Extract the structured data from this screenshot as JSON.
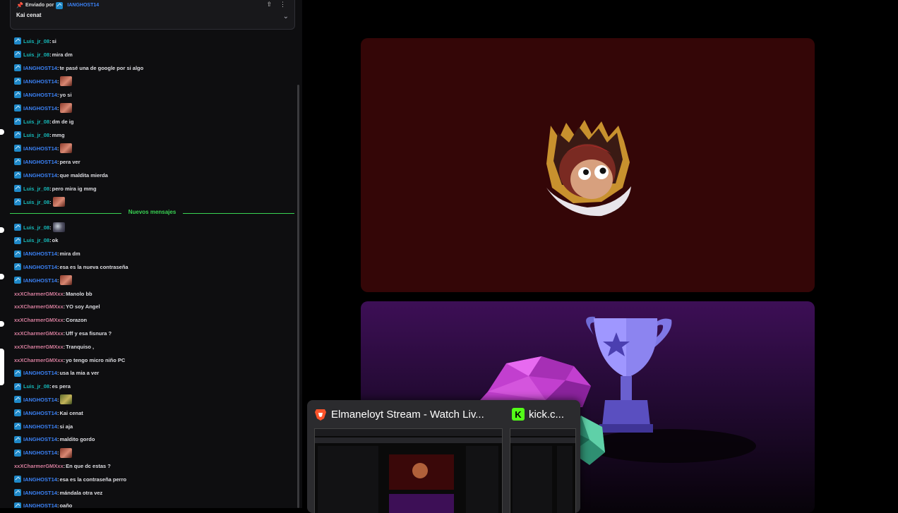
{
  "pinned": {
    "label": "Enviado por",
    "author": "IANGHOST14",
    "message": "Kai cenat"
  },
  "separator": {
    "label": "Nuevos mensajes"
  },
  "messages": [
    {
      "user": "Luis_jr_08",
      "color": "#16b9b9",
      "text": "si",
      "badge": true,
      "emote": ""
    },
    {
      "user": "Luis_jr_08",
      "color": "#16b9b9",
      "text": "mira dm",
      "badge": true,
      "emote": ""
    },
    {
      "user": "IANGHOST14",
      "color": "#3b82f6",
      "text": "te pasé una de google por si algo",
      "badge": true,
      "emote": ""
    },
    {
      "user": "IANGHOST14",
      "color": "#3b82f6",
      "text": "",
      "badge": true,
      "emote": "face"
    },
    {
      "user": "IANGHOST14",
      "color": "#3b82f6",
      "text": "yo si",
      "badge": true,
      "emote": ""
    },
    {
      "user": "IANGHOST14",
      "color": "#3b82f6",
      "text": "",
      "badge": true,
      "emote": "face"
    },
    {
      "user": "Luis_jr_08",
      "color": "#16b9b9",
      "text": "dm de ig",
      "badge": true,
      "emote": ""
    },
    {
      "user": "Luis_jr_08",
      "color": "#16b9b9",
      "text": "mmg",
      "badge": true,
      "emote": ""
    },
    {
      "user": "IANGHOST14",
      "color": "#3b82f6",
      "text": "",
      "badge": true,
      "emote": "face"
    },
    {
      "user": "IANGHOST14",
      "color": "#3b82f6",
      "text": "pera ver",
      "badge": true,
      "emote": ""
    },
    {
      "user": "IANGHOST14",
      "color": "#3b82f6",
      "text": "que maldita mierda",
      "badge": true,
      "emote": ""
    },
    {
      "user": "Luis_jr_08",
      "color": "#16b9b9",
      "text": "pero mira ig mmg",
      "badge": true,
      "emote": ""
    },
    {
      "user": "Luis_jr_08",
      "color": "#16b9b9",
      "text": "",
      "badge": true,
      "emote": "face"
    },
    {
      "user": "Luis_jr_08",
      "color": "#16b9b9",
      "text": "",
      "badge": true,
      "emote": "mouse"
    },
    {
      "user": "Luis_jr_08",
      "color": "#16b9b9",
      "text": "ok",
      "badge": true,
      "emote": ""
    },
    {
      "user": "IANGHOST14",
      "color": "#3b82f6",
      "text": "mira dm",
      "badge": true,
      "emote": ""
    },
    {
      "user": "IANGHOST14",
      "color": "#3b82f6",
      "text": "esa es la nueva contraseña",
      "badge": true,
      "emote": ""
    },
    {
      "user": "IANGHOST14",
      "color": "#3b82f6",
      "text": "",
      "badge": true,
      "emote": "face"
    },
    {
      "user": "xxXCharmerGMXxx",
      "color": "#d57d9c",
      "text": "Manolo bb",
      "badge": false,
      "emote": ""
    },
    {
      "user": "xxXCharmerGMXxx",
      "color": "#d57d9c",
      "text": "YO soy Angel",
      "badge": false,
      "emote": ""
    },
    {
      "user": "xxXCharmerGMXxx",
      "color": "#d57d9c",
      "text": "Corazon",
      "badge": false,
      "emote": ""
    },
    {
      "user": "xxXCharmerGMXxx",
      "color": "#d57d9c",
      "text": "Uff y esa fisnura ?",
      "badge": false,
      "emote": ""
    },
    {
      "user": "xxXCharmerGMXxx",
      "color": "#d57d9c",
      "text": "Tranquiso ,",
      "badge": false,
      "emote": ""
    },
    {
      "user": "xxXCharmerGMXxx",
      "color": "#d57d9c",
      "text": "yo tengo micro niño PC",
      "badge": false,
      "emote": ""
    },
    {
      "user": "IANGHOST14",
      "color": "#3b82f6",
      "text": "usa la mia a ver",
      "badge": true,
      "emote": ""
    },
    {
      "user": "Luis_jr_08",
      "color": "#16b9b9",
      "text": "es pera",
      "badge": true,
      "emote": ""
    },
    {
      "user": "IANGHOST14",
      "color": "#3b82f6",
      "text": "",
      "badge": true,
      "emote": "cat"
    },
    {
      "user": "IANGHOST14",
      "color": "#3b82f6",
      "text": "Kai cenat",
      "badge": true,
      "emote": ""
    },
    {
      "user": "IANGHOST14",
      "color": "#3b82f6",
      "text": "si aja",
      "badge": true,
      "emote": ""
    },
    {
      "user": "IANGHOST14",
      "color": "#3b82f6",
      "text": "maldito gordo",
      "badge": true,
      "emote": ""
    },
    {
      "user": "IANGHOST14",
      "color": "#3b82f6",
      "text": "",
      "badge": true,
      "emote": "face"
    },
    {
      "user": "xxXCharmerGMXxx",
      "color": "#d57d9c",
      "text": "En que dc estas ?",
      "badge": false,
      "emote": ""
    },
    {
      "user": "IANGHOST14",
      "color": "#3b82f6",
      "text": "esa es la contraseña perro",
      "badge": true,
      "emote": ""
    },
    {
      "user": "IANGHOST14",
      "color": "#3b82f6",
      "text": "mándala otra vez",
      "badge": true,
      "emote": ""
    },
    {
      "user": "IANGHOST14",
      "color": "#3b82f6",
      "text": "oaño",
      "badge": true,
      "emote": ""
    }
  ],
  "taskbar_preview": {
    "window1_title": "Elmaneloyt Stream - Watch Liv...",
    "window2_title": "kick.c...",
    "window2_icon_letter": "K"
  },
  "colors": {
    "kick_green": "#53fc18",
    "new_messages": "#39d353",
    "red_card": "#340607"
  }
}
